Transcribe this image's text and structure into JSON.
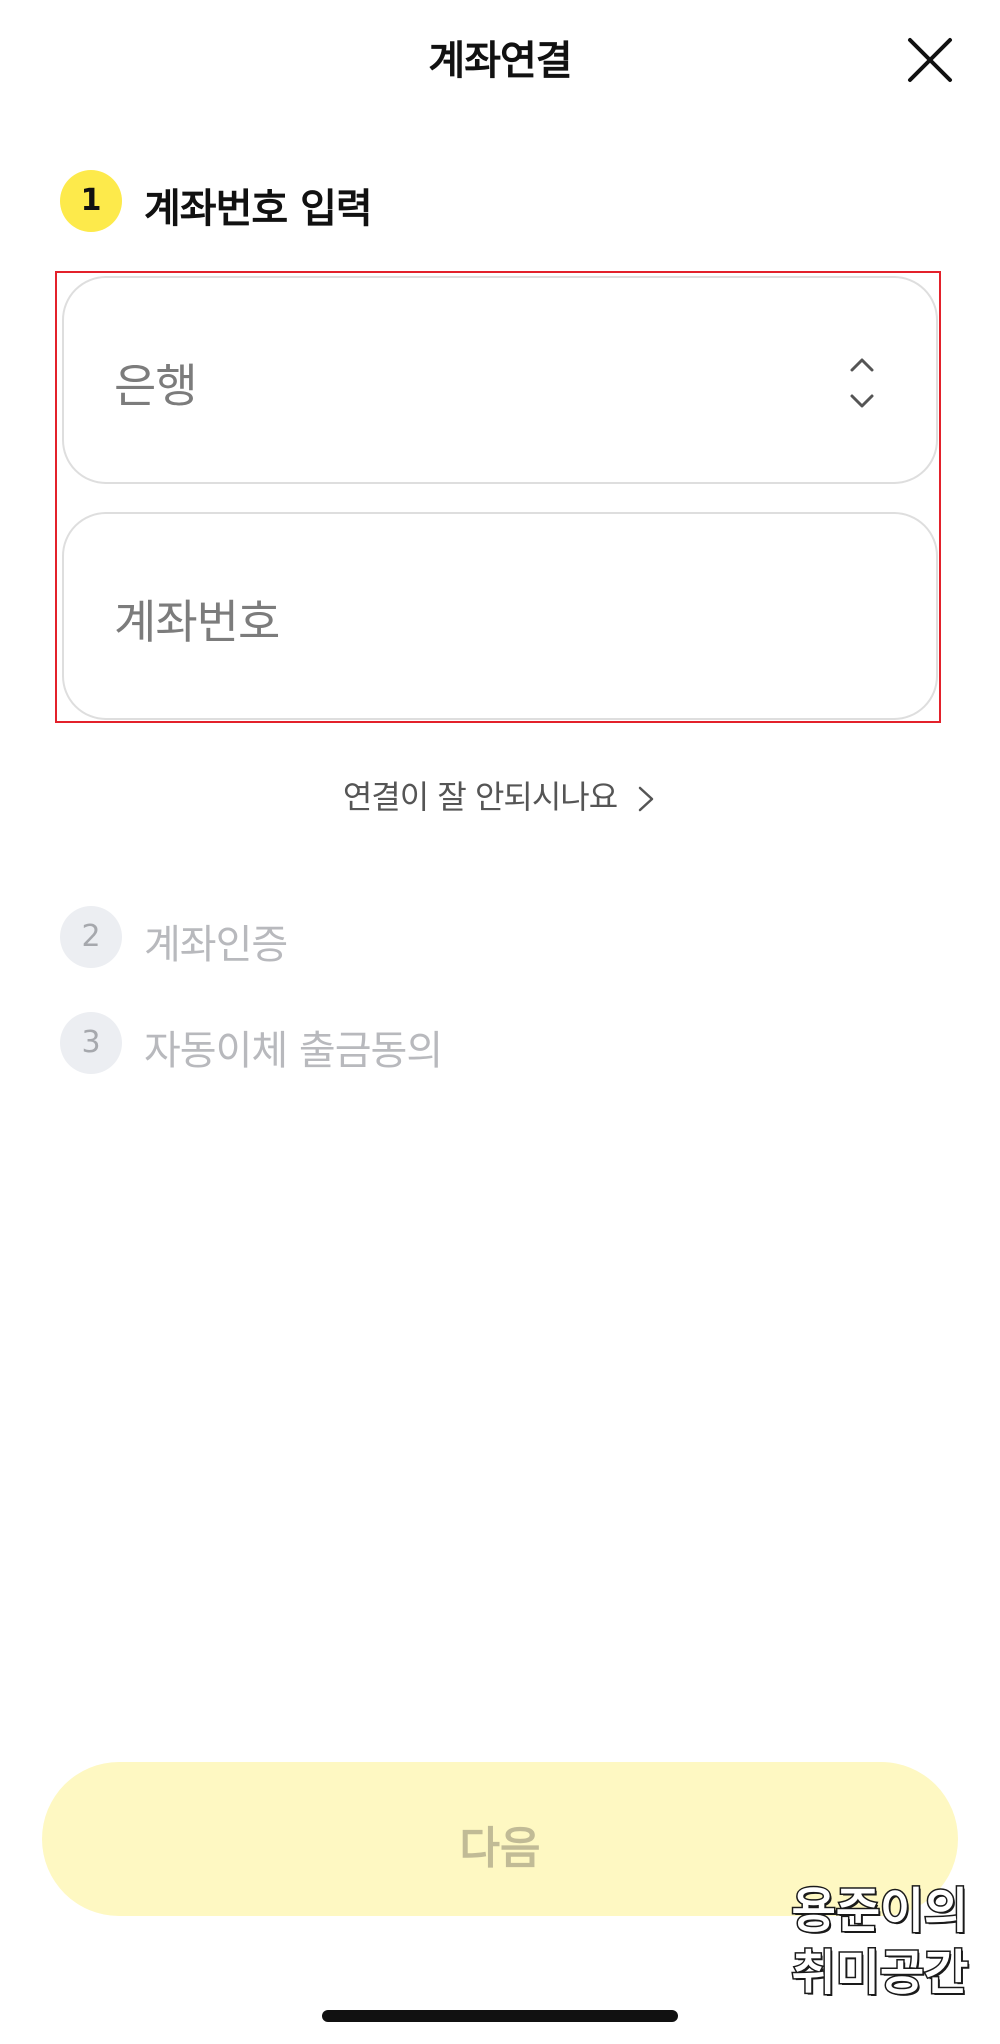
{
  "header": {
    "title": "계좌연결",
    "close_icon": "close-icon"
  },
  "steps": [
    {
      "number": "1",
      "label": "계좌번호 입력",
      "state": "active"
    },
    {
      "number": "2",
      "label": "계좌인증",
      "state": "inactive"
    },
    {
      "number": "3",
      "label": "자동이체 출금동의",
      "state": "inactive"
    }
  ],
  "form": {
    "bank_placeholder": "은행",
    "bank_icon": "updown-chevron-icon",
    "account_placeholder": "계좌번호"
  },
  "help": {
    "label": "연결이 잘 안되시나요",
    "icon": "chevron-right-icon"
  },
  "footer": {
    "next_label": "다음"
  },
  "watermark": {
    "line1": "용준이의",
    "line2": "취미공간"
  },
  "colors": {
    "accent_yellow": "#fdea4b",
    "button_disabled_bg": "#fef8c2",
    "highlight_red": "#e3212b",
    "inactive_badge": "#eceef2"
  }
}
